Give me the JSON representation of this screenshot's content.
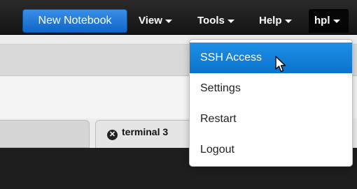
{
  "navbar": {
    "new_notebook": "New Notebook",
    "menus": {
      "view": "View",
      "tools": "Tools",
      "help": "Help",
      "user": "hpl"
    }
  },
  "tabs": {
    "terminal": "terminal 3"
  },
  "dropdown": {
    "items": [
      {
        "label": "SSH Access",
        "active": true
      },
      {
        "label": "Settings"
      },
      {
        "label": "Restart"
      },
      {
        "label": "Logout"
      }
    ]
  },
  "colors": {
    "navbar": "#1c1c1c",
    "accent": "#1278d6",
    "terminal_bg": "#1e1e1e"
  }
}
